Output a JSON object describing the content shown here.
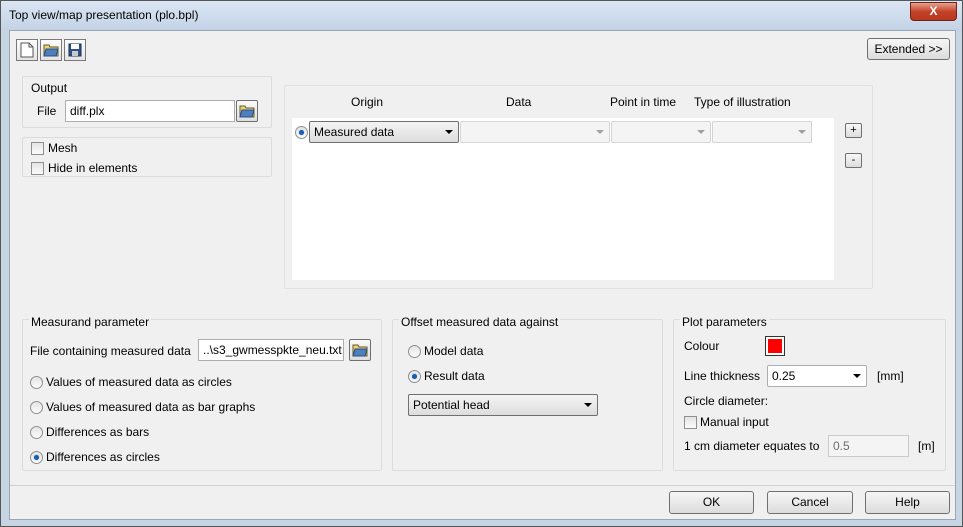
{
  "window": {
    "title": "Top view/map presentation (plo.bpl)",
    "close_label": "X"
  },
  "toolbar": {
    "new_icon": "new-document-icon",
    "open_icon": "open-folder-icon",
    "save_icon": "save-disk-icon",
    "extended_label": "Extended >>"
  },
  "output": {
    "group_label": "Output",
    "file_label": "File",
    "file_value": "diff.plx"
  },
  "options": {
    "mesh_label": "Mesh",
    "mesh_checked": false,
    "hide_label": "Hide in elements",
    "hide_checked": false
  },
  "table": {
    "columns": [
      "Origin",
      "Data",
      "Point in time",
      "Type of illustration"
    ],
    "rows": [
      {
        "selected": true,
        "origin": "Measured data",
        "data": "",
        "time": "",
        "illustration": ""
      }
    ],
    "add_label": "+",
    "remove_label": "-"
  },
  "measurand": {
    "group_label": "Measurand parameter",
    "file_label": "File containing measured data",
    "file_value": "..\\s3_gwmesspkte_neu.txt",
    "radios": [
      {
        "label": "Values of measured data as circles",
        "checked": false
      },
      {
        "label": "Values of measured data as bar graphs",
        "checked": false
      },
      {
        "label": "Differences as bars",
        "checked": false
      },
      {
        "label": "Differences as circles",
        "checked": true
      }
    ]
  },
  "offset": {
    "group_label": "Offset measured data against",
    "model_label": "Model data",
    "model_checked": false,
    "result_label": "Result data",
    "result_checked": true,
    "select_value": "Potential head"
  },
  "plot": {
    "group_label": "Plot parameters",
    "colour_label": "Colour",
    "colour_value": "#ff0000",
    "thickness_label": "Line thickness",
    "thickness_value": "0.25",
    "thickness_unit": "[mm]",
    "circle_label": "Circle diameter:",
    "manual_label": "Manual input",
    "manual_checked": false,
    "equates_label": "1 cm diameter equates to",
    "equates_value": "0.5",
    "equates_unit": "[m]"
  },
  "buttons": {
    "ok": "OK",
    "cancel": "Cancel",
    "help": "Help"
  }
}
